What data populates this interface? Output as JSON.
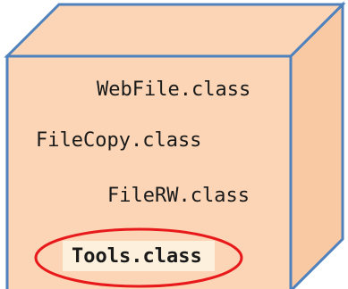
{
  "diagram": {
    "files": [
      {
        "label": "WebFile.class",
        "highlighted": false
      },
      {
        "label": "FileCopy.class",
        "highlighted": false
      },
      {
        "label": "FileRW.class",
        "highlighted": false
      },
      {
        "label": "Tools.class",
        "highlighted": true
      }
    ],
    "colors": {
      "front_face": "#fbd5b5",
      "top_face": "#fbd5b5",
      "side_face": "#f9c9a4",
      "edge": "#4f81bd",
      "highlight_ellipse": "#e8191b",
      "highlight_fill": "#fdf0dc",
      "text": "#1a1a1a"
    }
  }
}
